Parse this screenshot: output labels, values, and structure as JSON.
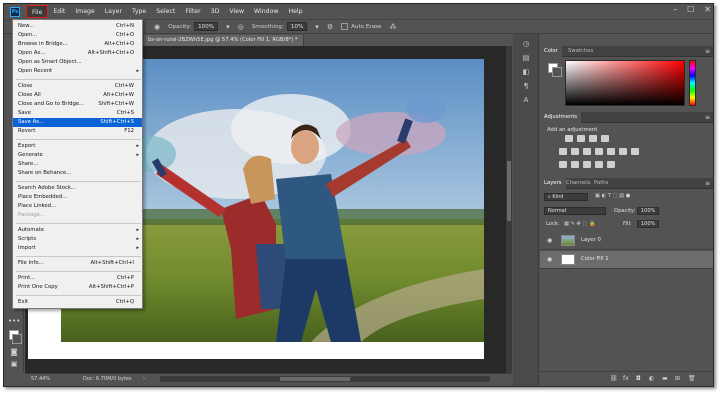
{
  "menubar": {
    "logo": "Ps",
    "items": [
      "File",
      "Edit",
      "Image",
      "Layer",
      "Type",
      "Select",
      "Filter",
      "3D",
      "View",
      "Window",
      "Help"
    ],
    "window_controls": [
      "–",
      "☐",
      "✕"
    ]
  },
  "options_bar": {
    "opacity_label": "Opacity:",
    "opacity_value": "100%",
    "smoothing_label": "Smoothing:",
    "smoothing_value": "10%",
    "auto_erase_label": "Auto Erase"
  },
  "document_tab": {
    "title": "bs-on-rural-2BZWh5E.jpg @ 57.4% (Color Fill 1, RGB/8*) *",
    "close": "×"
  },
  "file_menu": {
    "items": [
      {
        "label": "New...",
        "shortcut": "Ctrl+N"
      },
      {
        "label": "Open...",
        "shortcut": "Ctrl+O"
      },
      {
        "label": "Browse in Bridge...",
        "shortcut": "Alt+Ctrl+O"
      },
      {
        "label": "Open As...",
        "shortcut": "Alt+Shift+Ctrl+O"
      },
      {
        "label": "Open as Smart Object..."
      },
      {
        "label": "Open Recent",
        "submenu": "▸"
      },
      {
        "label": "Close",
        "shortcut": "Ctrl+W"
      },
      {
        "label": "Close All",
        "shortcut": "Alt+Ctrl+W"
      },
      {
        "label": "Close and Go to Bridge...",
        "shortcut": "Shift+Ctrl+W"
      },
      {
        "label": "Save",
        "shortcut": "Ctrl+S"
      },
      {
        "label": "Save As...",
        "shortcut": "Shift+Ctrl+S"
      },
      {
        "label": "Revert",
        "shortcut": "F12"
      },
      {
        "label": "Export",
        "submenu": "▸"
      },
      {
        "label": "Generate",
        "submenu": "▸"
      },
      {
        "label": "Share..."
      },
      {
        "label": "Share on Behance..."
      },
      {
        "label": "Search Adobe Stock..."
      },
      {
        "label": "Place Embedded..."
      },
      {
        "label": "Place Linked..."
      },
      {
        "label": "Package..."
      },
      {
        "label": "Automate",
        "submenu": "▸"
      },
      {
        "label": "Scripts",
        "submenu": "▸"
      },
      {
        "label": "Import",
        "submenu": "▸"
      },
      {
        "label": "File Info...",
        "shortcut": "Alt+Shift+Ctrl+I"
      },
      {
        "label": "Print...",
        "shortcut": "Ctrl+P"
      },
      {
        "label": "Print One Copy",
        "shortcut": "Alt+Shift+Ctrl+P"
      },
      {
        "label": "Exit",
        "shortcut": "Ctrl+Q"
      }
    ]
  },
  "color_panel": {
    "tabs": [
      "Color",
      "Swatches"
    ],
    "foreground_color": "#ffffff",
    "background_color": "#535353"
  },
  "adjustments_panel": {
    "tab": "Adjustments",
    "subtitle": "Add an adjustment"
  },
  "layers_panel": {
    "tabs": [
      "Layers",
      "Channels",
      "Paths"
    ],
    "kind_label": "Kind",
    "blend_mode": "Normal",
    "opacity_label": "Opacity:",
    "opacity_value": "100%",
    "lock_label": "Lock:",
    "fill_label": "Fill:",
    "fill_value": "100%",
    "layers": [
      {
        "name": "Layer 0",
        "selected": false
      },
      {
        "name": "Color Fill 1",
        "selected": true
      }
    ]
  },
  "status_bar": {
    "zoom": "57.44%",
    "doc_info": "Doc: 6.70M/0 bytes",
    "arrow": "›"
  }
}
